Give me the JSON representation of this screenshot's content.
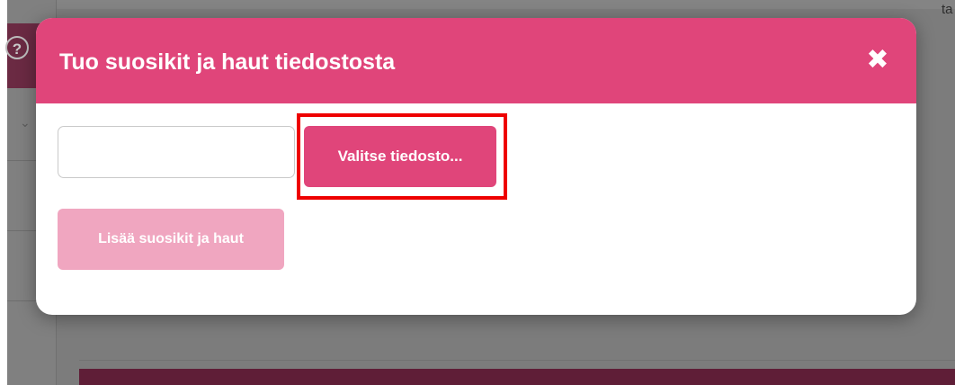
{
  "background": {
    "help_icon": "?",
    "chevron_icon": "chevron-down-icon",
    "corner_text": "ta"
  },
  "modal": {
    "title": "Tuo suosikit ja haut tiedostosta",
    "close_icon": "close-icon",
    "file_input_value": "",
    "choose_file_label": "Valitse tiedosto...",
    "add_button_label": "Lisää suosikit ja haut",
    "add_button_enabled": false
  },
  "colors": {
    "accent": "#e0457a",
    "accent_disabled": "#f0a6c0",
    "highlight": "#ee0000",
    "sidebar_active": "#6b2a43"
  }
}
